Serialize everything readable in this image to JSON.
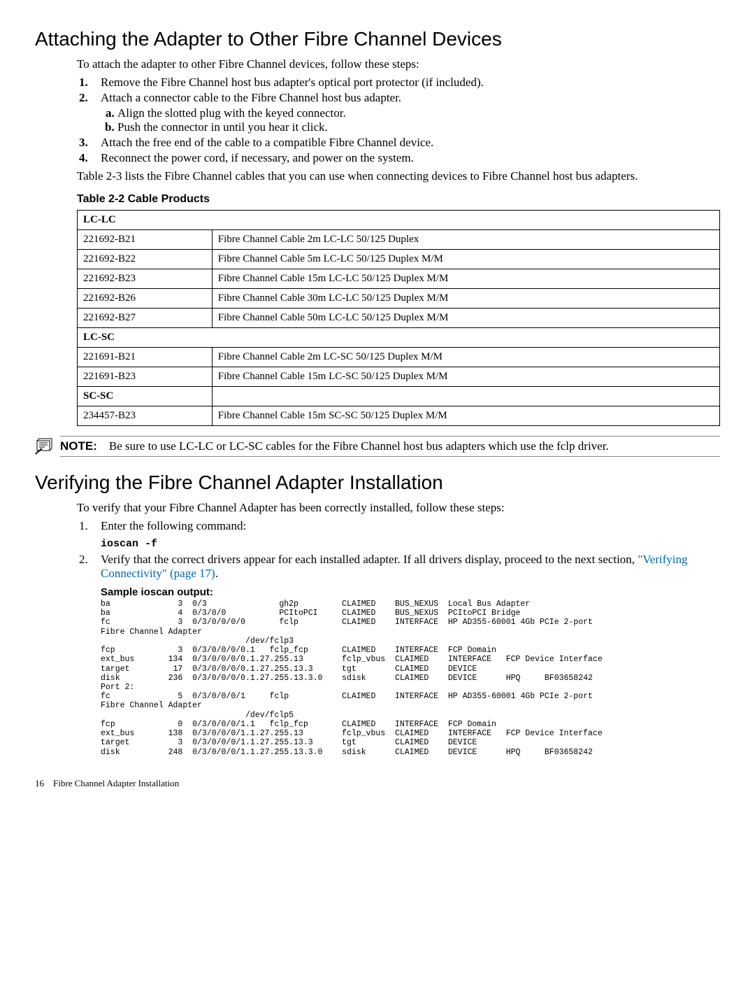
{
  "h1_attach": "Attaching the Adapter to Other Fibre Channel Devices",
  "attach_intro": "To attach the adapter to other Fibre Channel devices, follow these steps:",
  "steps": {
    "s1": "Remove the Fibre Channel host bus adapter's optical port protector (if included).",
    "s2": "Attach a connector cable to the Fibre Channel host bus adapter.",
    "s2a": "Align the slotted plug with the keyed connector.",
    "s2b": "Push the connector in until you hear it click.",
    "s3": "Attach the free end of the cable to a compatible Fibre Channel device.",
    "s4": "Reconnect the power cord, if necessary, and power on the system."
  },
  "table_ref": "Table 2-3 lists the Fibre Channel cables that you can use when connecting devices to Fibre Channel host bus adapters.",
  "table_caption": "Table  2-2  Cable Products",
  "t": {
    "lclc": "LC-LC",
    "r1a": "221692-B21",
    "r1b": "Fibre Channel Cable 2m LC-LC 50/125 Duplex",
    "r2a": "221692-B22",
    "r2b": "Fibre Channel Cable 5m LC-LC 50/125 Duplex M/M",
    "r3a": "221692-B23",
    "r3b": "Fibre Channel Cable 15m LC-LC 50/125 Duplex M/M",
    "r4a": "221692-B26",
    "r4b": "Fibre Channel Cable 30m LC-LC 50/125 Duplex M/M",
    "r5a": "221692-B27",
    "r5b": "Fibre Channel Cable 50m LC-LC 50/125 Duplex M/M",
    "lcsc": "LC-SC",
    "r6a": "221691-B21",
    "r6b": "Fibre Channel Cable 2m LC-SC 50/125 Duplex M/M",
    "r7a": "221691-B23",
    "r7b": "Fibre Channel Cable 15m LC-SC 50/125 Duplex M/M",
    "scsc": "SC-SC",
    "r8a": "234457-B23",
    "r8b": "Fibre Channel Cable 15m SC-SC 50/125 Duplex M/M"
  },
  "note_label": "NOTE:",
  "note_text": "Be sure to use LC-LC or LC-SC cables for the Fibre Channel host bus adapters which use the fclp driver.",
  "h1_verify": "Verifying the Fibre Channel Adapter Installation",
  "verify_intro": "To verify that your Fibre Channel Adapter has been correctly installed, follow these steps:",
  "vsteps": {
    "s1": "Enter the following command:",
    "cmd": "ioscan -f",
    "s2a": "Verify that the correct drivers appear for each installed adapter. If all drivers display, proceed to the next section, ",
    "s2link": "\"Verifying Connectivity\" (page 17)",
    "s2b": "."
  },
  "sample_head": "Sample ioscan output:",
  "ioscan": "ba              3  0/3               gh2p         CLAIMED    BUS_NEXUS  Local Bus Adapter\nba              4  0/3/0/0           PCItoPCI     CLAIMED    BUS_NEXUS  PCItoPCI Bridge\nfc              3  0/3/0/0/0/0       fclp         CLAIMED    INTERFACE  HP AD355-60001 4Gb PCIe 2-port\nFibre Channel Adapter\n                              /dev/fclp3\nfcp             3  0/3/0/0/0/0.1   fclp_fcp       CLAIMED    INTERFACE  FCP Domain\next_bus       134  0/3/0/0/0/0.1.27.255.13        fclp_vbus  CLAIMED    INTERFACE   FCP Device Interface\ntarget         17  0/3/0/0/0/0.1.27.255.13.3      tgt        CLAIMED    DEVICE\ndisk          236  0/3/0/0/0/0.1.27.255.13.3.0    sdisk      CLAIMED    DEVICE      HPQ     BF03658242\nPort 2:\nfc              5  0/3/0/0/0/1     fclp           CLAIMED    INTERFACE  HP AD355-60001 4Gb PCIe 2-port\nFibre Channel Adapter\n                              /dev/fclp5\nfcp             0  0/3/0/0/0/1.1   fclp_fcp       CLAIMED    INTERFACE  FCP Domain\next_bus       138  0/3/0/0/0/1.1.27.255.13        fclp_vbus  CLAIMED    INTERFACE   FCP Device Interface\ntarget          3  0/3/0/0/0/1.1.27.255.13.3      tgt        CLAIMED    DEVICE\ndisk          248  0/3/0/0/0/1.1.27.255.13.3.0    sdisk      CLAIMED    DEVICE      HPQ     BF03658242",
  "footer_page": "16",
  "footer_text": "Fibre Channel Adapter Installation"
}
